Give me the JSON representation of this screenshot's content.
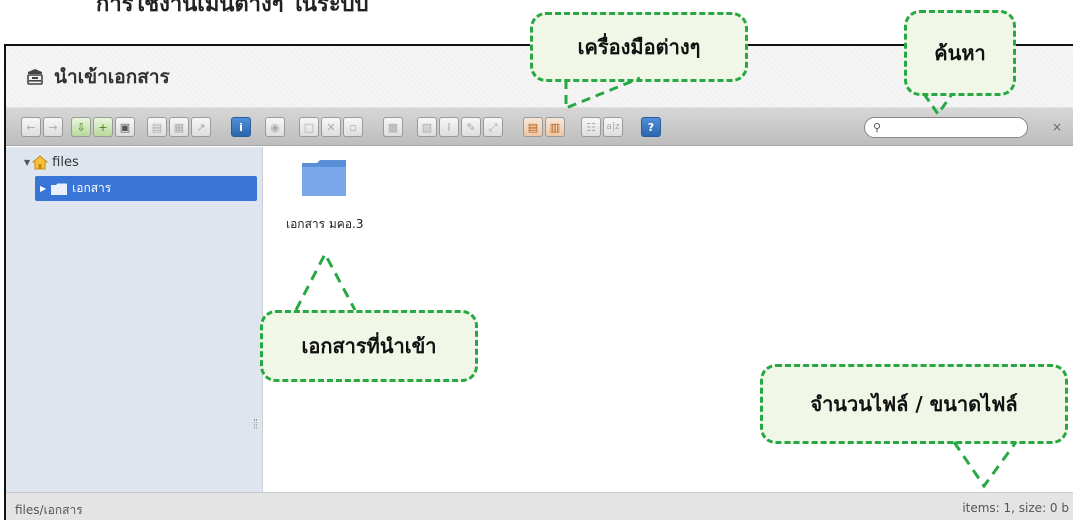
{
  "heading_fragment": "การใช้งานเมนูต่างๆ ในระบบ",
  "window": {
    "title": "นำเข้าเอกสาร"
  },
  "toolbar": {
    "search_placeholder": ""
  },
  "sidebar": {
    "root_label": "files",
    "selected_folder": "เอกสาร"
  },
  "content": {
    "files": [
      {
        "name": "เอกสาร มคอ.3",
        "type": "folder"
      }
    ]
  },
  "statusbar": {
    "path": "files/เอกสาร",
    "summary": "items: 1, size: 0 b"
  },
  "callouts": {
    "tools": "เครื่องมือต่างๆ",
    "search": "ค้นหา",
    "imported": "เอกสารที่นำเข้า",
    "file_count": "จำนวนไฟล์ / ขนาดไฟล์"
  },
  "colors": {
    "callout_border": "#27a844",
    "selected_node": "#3875d7",
    "sidebar_bg": "#dee5ee",
    "folder": "#6f9de0"
  }
}
